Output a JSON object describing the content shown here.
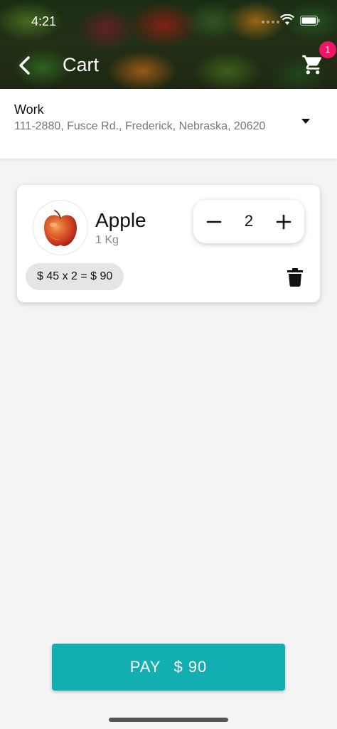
{
  "status_bar": {
    "time": "4:21"
  },
  "header": {
    "title": "Cart",
    "cart_badge_count": "1",
    "icons": {
      "back": "chevron-left-icon",
      "cart": "shopping-cart-icon"
    }
  },
  "address": {
    "label": "Work",
    "line": "111-2880, Fusce Rd., Frederick, Nebraska, 20620"
  },
  "cart_items": [
    {
      "name": "Apple",
      "weight": "1 Kg",
      "quantity": "2",
      "price_line": "$ 45 x 2 = $ 90"
    }
  ],
  "pay": {
    "label": "PAY",
    "amount": "$ 90"
  },
  "colors": {
    "accent": "#13aeb1",
    "badge": "#ee1466",
    "background": "#f4f4f4"
  }
}
